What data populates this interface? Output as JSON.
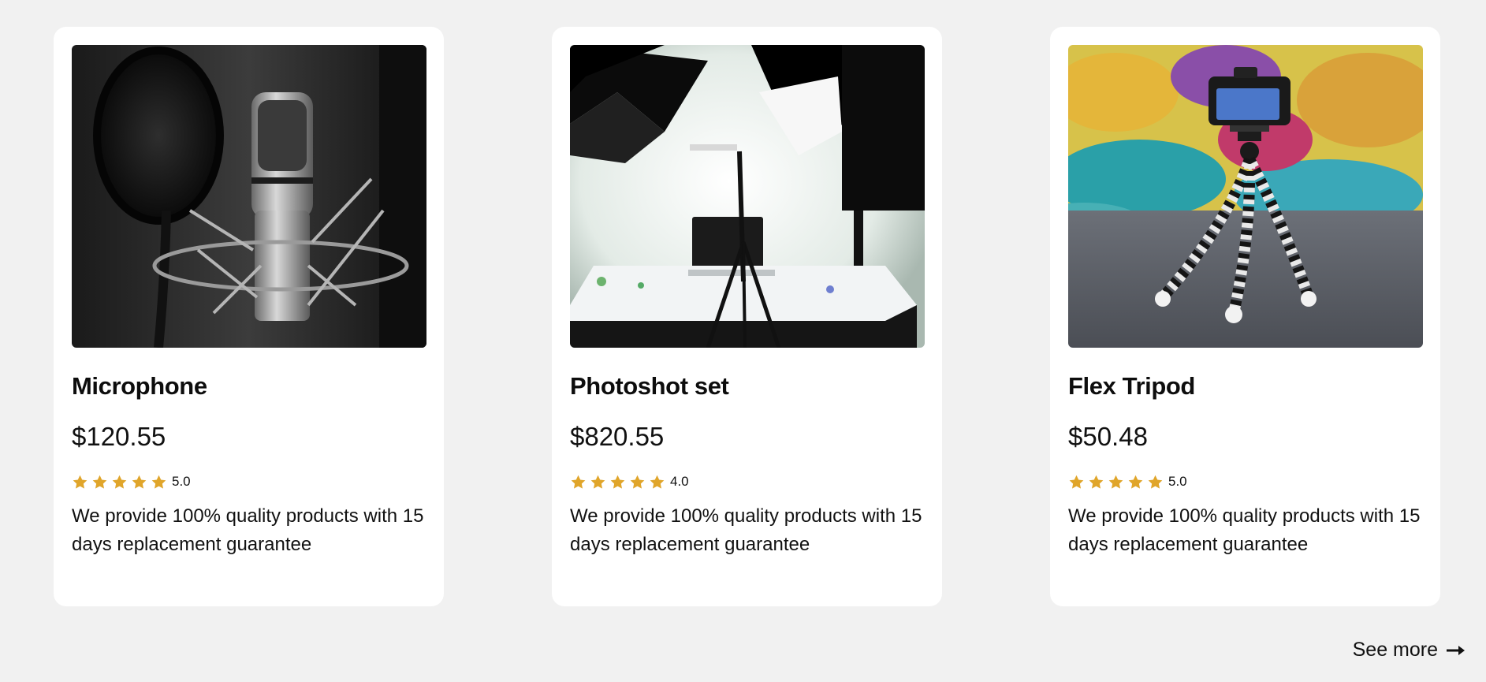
{
  "colors": {
    "background": "#f1f1f1",
    "card": "#ffffff",
    "star": "#e0a52a",
    "text": "#111111"
  },
  "products": [
    {
      "title": "Microphone",
      "price": "$120.55",
      "rating": "5.0",
      "stars": 5,
      "description": "We provide 100% quality products with 15 days replacement guarantee",
      "image_icon": "microphone-photo"
    },
    {
      "title": "Photoshot set",
      "price": "$820.55",
      "rating": "4.0",
      "stars": 5,
      "description": "We provide 100% quality products with 15 days replacement guarantee",
      "image_icon": "photo-studio-photo"
    },
    {
      "title": "Flex Tripod",
      "price": "$50.48",
      "rating": "5.0",
      "stars": 5,
      "description": "We provide 100% quality products with 15 days replacement guarantee",
      "image_icon": "tripod-photo"
    }
  ],
  "see_more": {
    "label": "See more",
    "icon": "arrow-right-icon"
  }
}
